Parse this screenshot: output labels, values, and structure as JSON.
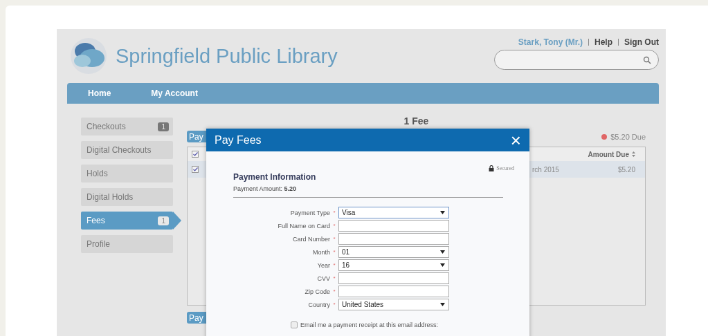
{
  "header": {
    "title": "Springfield Public Library",
    "user_link": "Stark, Tony (Mr.)",
    "links": [
      "Help",
      "Sign Out"
    ]
  },
  "nav": [
    {
      "label": "Home"
    },
    {
      "label": "My Account"
    }
  ],
  "sidebar": {
    "items": [
      {
        "label": "Checkouts",
        "badge": "1",
        "selected": false
      },
      {
        "label": "Digital Checkouts",
        "selected": false
      },
      {
        "label": "Holds",
        "selected": false
      },
      {
        "label": "Digital Holds",
        "selected": false
      },
      {
        "label": "Fees",
        "badge": "1",
        "selected": true
      },
      {
        "label": "Profile",
        "selected": false
      }
    ]
  },
  "main": {
    "title": "1 Fee",
    "pay_button": "Pay",
    "due": {
      "text": "$5.20 Due",
      "color": "#e06666"
    },
    "table": {
      "header": {
        "checked": true,
        "amount_column": "Amount Due"
      },
      "rows": [
        {
          "checked": true,
          "date": "rch 2015",
          "amount": "$5.20",
          "selected": true
        }
      ]
    },
    "pay_button_bottom": "Pay"
  },
  "modal": {
    "title": "Pay Fees",
    "close": "×",
    "secured": "Secured",
    "heading": "Payment Information",
    "amount": "Payment Amount: **5.20**",
    "fields": [
      {
        "label": "Payment Type",
        "kind": "select",
        "value": "Visa",
        "focused": true
      },
      {
        "label": "Full Name on Card",
        "kind": "text"
      },
      {
        "label": "Card Number",
        "kind": "text"
      },
      {
        "label": "Month",
        "kind": "select",
        "value": "01"
      },
      {
        "label": "Year",
        "kind": "select",
        "value": "16"
      },
      {
        "label": "CVV",
        "kind": "text"
      },
      {
        "label": "Zip Code",
        "kind": "text"
      },
      {
        "label": "Country",
        "kind": "select",
        "value": "United States"
      }
    ],
    "required_mark": "*",
    "email_receipt": {
      "label": "Email me a payment receipt at this email address:",
      "checked": false
    }
  }
}
